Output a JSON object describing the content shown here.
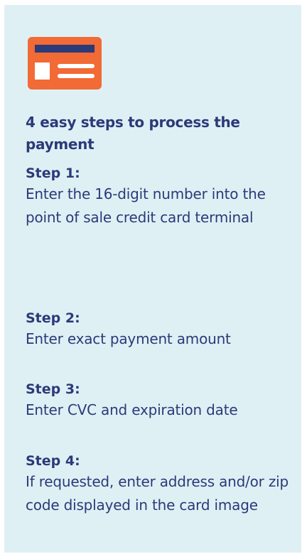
{
  "icon": {
    "name": "credit-card-icon",
    "color": "#f26a35",
    "stripe_color": "#2b3a78"
  },
  "heading": "4 easy steps to process the payment",
  "steps": [
    {
      "title": "Step 1:",
      "body": "Enter the 16-digit number into the point of sale credit card terminal"
    },
    {
      "title": "Step 2:",
      "body": "Enter exact payment amount"
    },
    {
      "title": "Step 3:",
      "body": "Enter CVC and expiration date"
    },
    {
      "title": "Step 4:",
      "body": "If requested, enter address and/or zip code displayed in the card image"
    }
  ],
  "colors": {
    "panel_background": "#dff0f5",
    "text": "#2b3a78"
  }
}
